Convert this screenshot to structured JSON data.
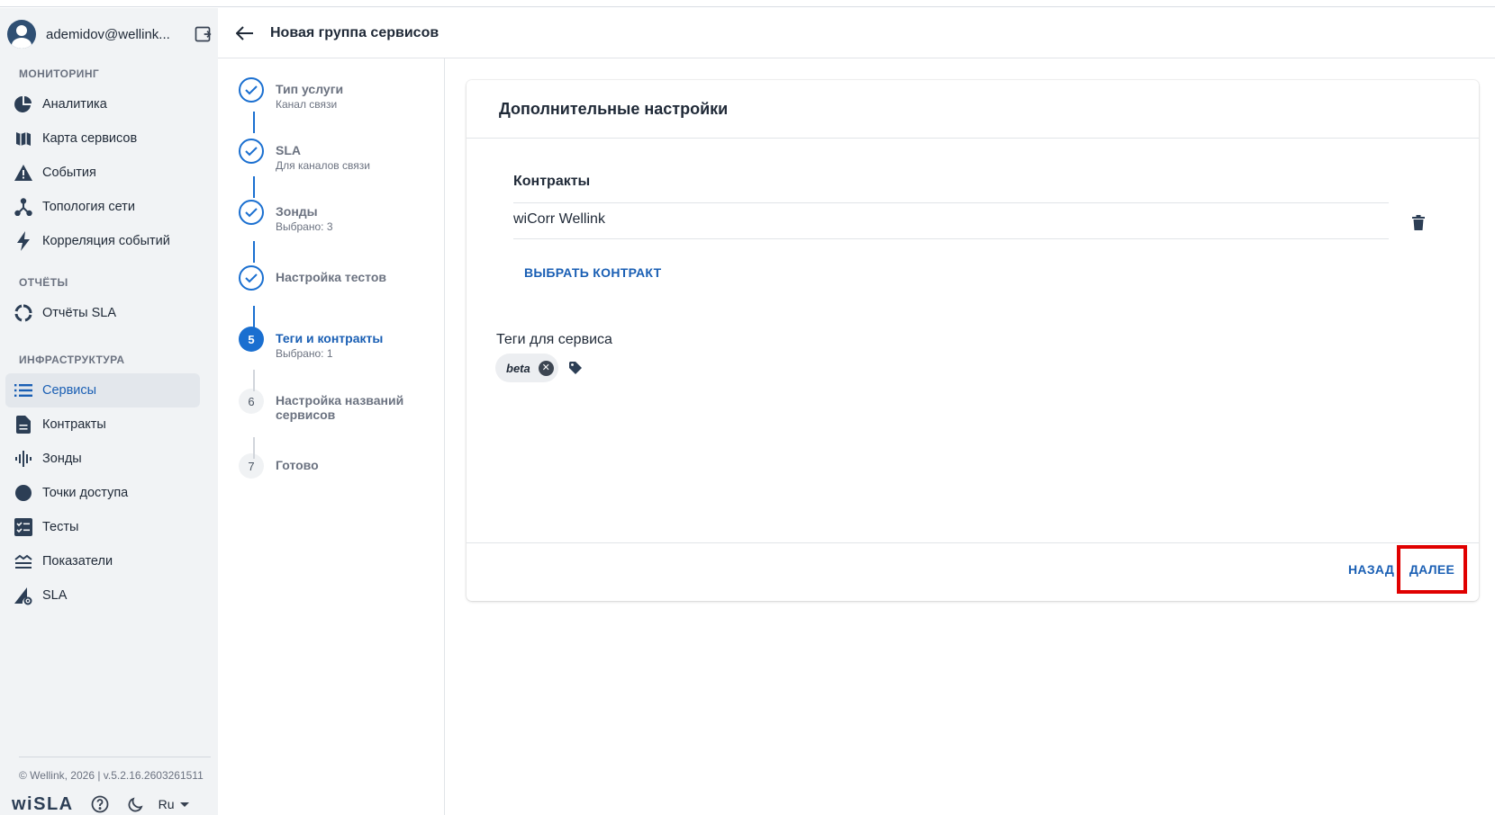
{
  "user": {
    "email": "ademidov@wellink..."
  },
  "sidebar": {
    "sections": [
      {
        "title": "МОНИТОРИНГ",
        "items": [
          {
            "label": "Аналитика",
            "icon": "pie-chart-icon"
          },
          {
            "label": "Карта сервисов",
            "icon": "map-icon"
          },
          {
            "label": "События",
            "icon": "warning-icon"
          },
          {
            "label": "Топология сети",
            "icon": "topology-icon"
          },
          {
            "label": "Корреляция событий",
            "icon": "bolt-icon"
          }
        ]
      },
      {
        "title": "ОТЧЁТЫ",
        "items": [
          {
            "label": "Отчёты SLA",
            "icon": "donut-icon"
          }
        ]
      },
      {
        "title": "ИНФРАСТРУКТУРА",
        "items": [
          {
            "label": "Сервисы",
            "icon": "list-icon",
            "active": true
          },
          {
            "label": "Контракты",
            "icon": "document-icon"
          },
          {
            "label": "Зонды",
            "icon": "waveform-icon"
          },
          {
            "label": "Точки доступа",
            "icon": "circle-icon"
          },
          {
            "label": "Тесты",
            "icon": "checklist-icon"
          },
          {
            "label": "Показатели",
            "icon": "metrics-icon"
          },
          {
            "label": "SLA",
            "icon": "sla-settings-icon"
          }
        ]
      }
    ],
    "copyright": "© Wellink, 2026 | v.5.2.16.2603261511",
    "brand": "wiSLA",
    "language": "Ru"
  },
  "header": {
    "title": "Новая группа сервисов"
  },
  "stepper": {
    "steps": [
      {
        "title": "Тип услуги",
        "subtitle": "Канал связи",
        "state": "done",
        "number": "1"
      },
      {
        "title": "SLA",
        "subtitle": "Для каналов связи",
        "state": "done",
        "number": "2"
      },
      {
        "title": "Зонды",
        "subtitle": "Выбрано: 3",
        "state": "done",
        "number": "3"
      },
      {
        "title": "Настройка тестов",
        "subtitle": "",
        "state": "done",
        "number": "4"
      },
      {
        "title": "Теги и контракты",
        "subtitle": "Выбрано: 1",
        "state": "current",
        "number": "5"
      },
      {
        "title": "Настройка названий сервисов",
        "subtitle": "",
        "state": "pending",
        "number": "6"
      },
      {
        "title": "Готово",
        "subtitle": "",
        "state": "pending",
        "number": "7"
      }
    ]
  },
  "card": {
    "title": "Дополнительные настройки",
    "contracts_label": "Контракты",
    "contracts": [
      "wiCorr Wellink"
    ],
    "choose_contract": "ВЫБРАТЬ КОНТРАКТ",
    "tags_label": "Теги для сервиса",
    "tags": [
      "beta"
    ],
    "back_button": "НАЗАД",
    "next_button": "ДАЛЕЕ"
  },
  "colors": {
    "primary": "#1a6fd0",
    "highlight": "#e00000",
    "sidebar_bg": "#f1f3f5"
  }
}
